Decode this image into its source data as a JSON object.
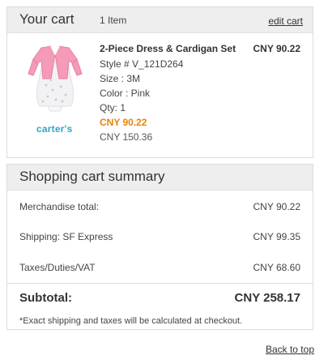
{
  "cart": {
    "title": "Your cart",
    "item_count": "1 Item",
    "edit_link": "edit cart"
  },
  "product": {
    "name": "2-Piece Dress & Cardigan Set",
    "price_right": "CNY 90.22",
    "style": "Style # V_121D264",
    "size": "Size : 3M",
    "color": "Color : Pink",
    "qty": "Qty: 1",
    "sale_price": "CNY 90.22",
    "original_price": "CNY 150.36",
    "brand": "carter's",
    "image_icon": "dress-cardigan-image"
  },
  "summary": {
    "title": "Shopping cart summary",
    "merch_label": "Merchandise total:",
    "merch_value": "CNY 90.22",
    "ship_label": "Shipping: SF Express",
    "ship_value": "CNY 99.35",
    "tax_label": "Taxes/Duties/VAT",
    "tax_value": "CNY 68.60",
    "subtotal_label": "Subtotal:",
    "subtotal_value": "CNY 258.17",
    "note": "*Exact shipping and taxes will be calculated at checkout."
  },
  "footer": {
    "back_to_top": "Back to top"
  },
  "colors": {
    "header_bg": "#eeeeee",
    "sale_orange": "#e8820c",
    "brand_blue": "#2ba6c9"
  }
}
